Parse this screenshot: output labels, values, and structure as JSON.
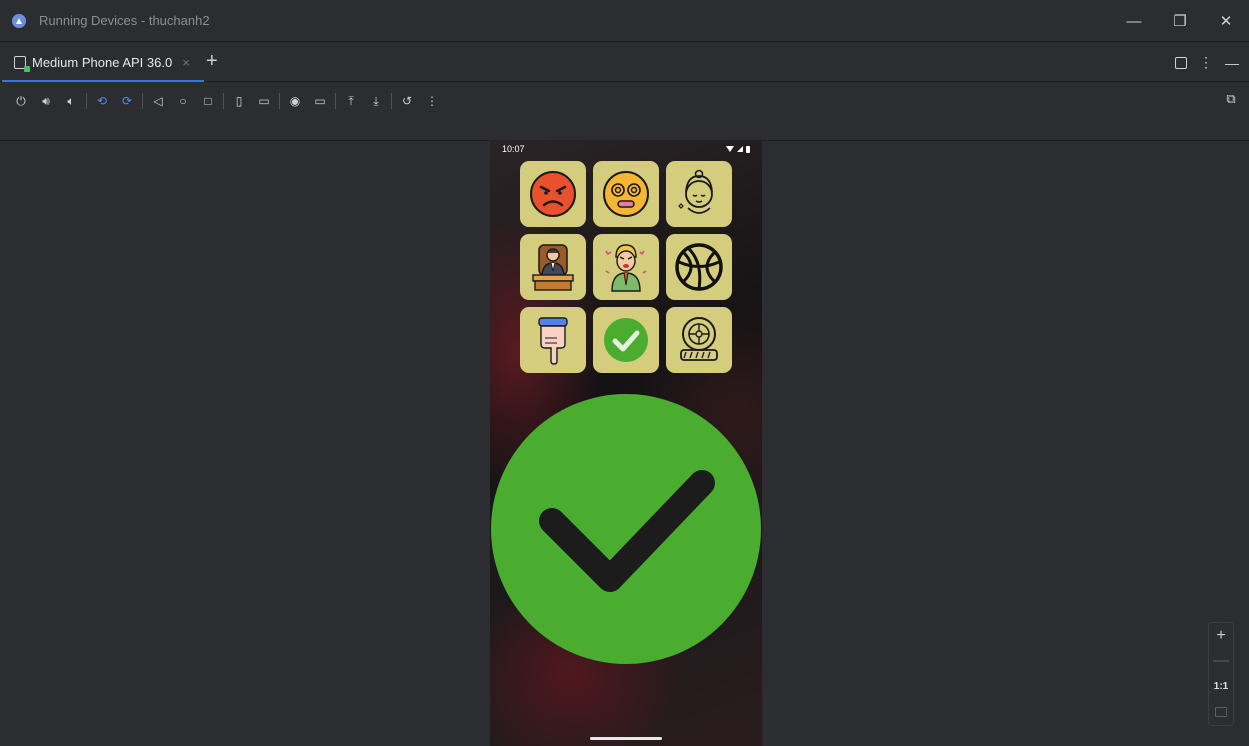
{
  "window": {
    "title": "Running Devices - thuchanh2",
    "minimize": "—",
    "restore": "❐",
    "close": "✕"
  },
  "tabs": [
    {
      "label": "Medium Phone API 36.0",
      "close": "×",
      "active": true
    }
  ],
  "tab_add": "+",
  "tab_actions": {
    "more": "⋮",
    "hide": "—"
  },
  "toolbar": {
    "power": "⏻",
    "volume_up": "🔊︎",
    "volume_down": "🔈︎",
    "rotate_left": "⟲",
    "rotate_right": "⟳",
    "back": "◁",
    "home": "○",
    "overview": "□",
    "screenshot": "◉",
    "record": "▭",
    "upload": "⤒",
    "download": "⤓",
    "reset": "↺",
    "more": "⋮"
  },
  "device": {
    "time": "10:07",
    "tiles": [
      {
        "name": "angry-face-icon"
      },
      {
        "name": "dizzy-face-icon"
      },
      {
        "name": "relaxed-woman-icon"
      },
      {
        "name": "boss-at-desk-icon"
      },
      {
        "name": "angry-man-icon"
      },
      {
        "name": "basketball-icon"
      },
      {
        "name": "pointing-hand-icon"
      },
      {
        "name": "check-icon"
      },
      {
        "name": "tire-icon"
      }
    ],
    "selected_result": "check-icon",
    "colors": {
      "tile": "#d4cd7d",
      "check_green": "#4aad2f",
      "angry_red": "#e8502e"
    }
  },
  "zoom": {
    "in": "+",
    "out": "—",
    "actual": "1:1"
  }
}
